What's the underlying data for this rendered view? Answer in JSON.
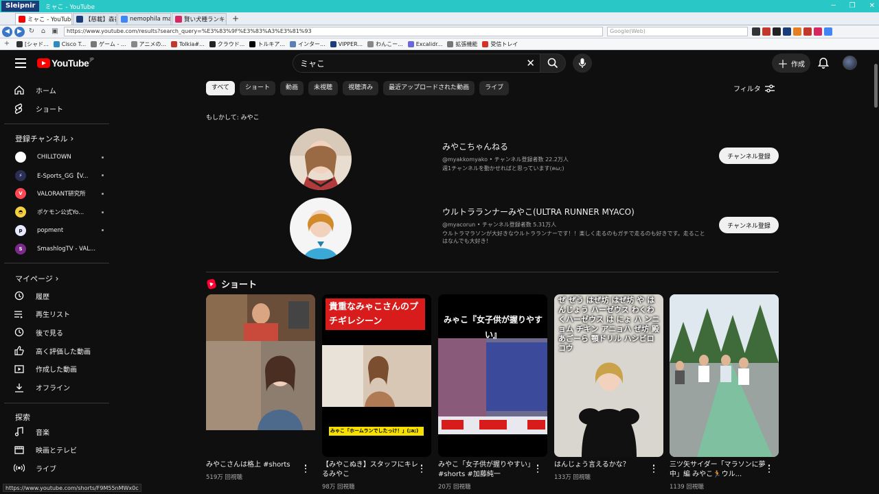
{
  "window": {
    "app": "Sleipnir",
    "title": "ミャこ - YouTube"
  },
  "tabs": [
    {
      "label": "ミャこ - YouTube",
      "color": "#ff0000",
      "active": true
    },
    {
      "label": "【慈載】森香澄 ...",
      "color": "#1a3d7a",
      "active": false
    },
    {
      "label": "nemophila may...",
      "color": "#4285f4",
      "active": false
    },
    {
      "label": "賢い犬種ランキン...",
      "color": "#d6275e",
      "active": false
    }
  ],
  "address": {
    "url": "https://www.youtube.com/results?search_query=%E3%83%9F%E3%83%A3%E3%81%93",
    "search_placeholder": "Google(Web)"
  },
  "bookmarks": [
    {
      "label": "[シャド...",
      "color": "#333333"
    },
    {
      "label": "Cisco T...",
      "color": "#2e8bc0"
    },
    {
      "label": "ゲーム - ...",
      "color": "#777777"
    },
    {
      "label": "アニメの...",
      "color": "#888888"
    },
    {
      "label": "Tolkia#...",
      "color": "#c0392b"
    },
    {
      "label": "クラウド...",
      "color": "#222222"
    },
    {
      "label": "トルキア...",
      "color": "#000000"
    },
    {
      "label": "インター...",
      "color": "#5a7fb5"
    },
    {
      "label": "VIPPER...",
      "color": "#1a3d7a"
    },
    {
      "label": "わんこー...",
      "color": "#888888"
    },
    {
      "label": "Excalidr...",
      "color": "#6965db"
    },
    {
      "label": "拡張機能",
      "color": "#777777"
    },
    {
      "label": "受信トレイ",
      "color": "#d93025"
    }
  ],
  "youtube": {
    "logo_text": "YouTube",
    "region": "JP",
    "search_query": "ミャこ",
    "create_label": "作成",
    "filter_label": "フィルタ",
    "chips": [
      "すべて",
      "ショート",
      "動画",
      "未視聴",
      "視聴済み",
      "最近アップロードされた動画",
      "ライブ"
    ],
    "suggest": "もしかして: みやこ",
    "sidebar": {
      "main": [
        {
          "label": "ホーム",
          "icon": "home-icon"
        },
        {
          "label": "ショート",
          "icon": "shorts-icon"
        }
      ],
      "subs_title": "登録チャンネル",
      "subs": [
        {
          "label": "CHILLTOWN",
          "color": "#ffffff",
          "initial": ""
        },
        {
          "label": "E-Sports_GG【V...",
          "color": "#2b2f55",
          "initial": "⚡"
        },
        {
          "label": "VALORANT研究所",
          "color": "#ff4655",
          "initial": "V"
        },
        {
          "label": "ポケモン公式Yo...",
          "color": "#f4d03f",
          "initial": "◓"
        },
        {
          "label": "popment",
          "color": "#e8eaff",
          "initial": "p"
        },
        {
          "label": "SmashlogTV - VAL...",
          "color": "#7b2a8a",
          "initial": "S"
        }
      ],
      "my_title": "マイページ",
      "my": [
        {
          "label": "履歴",
          "icon": "history-icon"
        },
        {
          "label": "再生リスト",
          "icon": "playlist-icon"
        },
        {
          "label": "後で見る",
          "icon": "watch-later-icon"
        },
        {
          "label": "高く評価した動画",
          "icon": "like-icon"
        },
        {
          "label": "作成した動画",
          "icon": "your-videos-icon"
        },
        {
          "label": "オフライン",
          "icon": "download-icon"
        }
      ],
      "explore_title": "探索",
      "explore": [
        {
          "label": "音楽",
          "icon": "music-icon"
        },
        {
          "label": "映画とテレビ",
          "icon": "movies-icon"
        },
        {
          "label": "ライブ",
          "icon": "live-icon"
        }
      ]
    },
    "channels": [
      {
        "name": "みやこちゃんねる",
        "meta": "@myakkomyako • チャンネル登録者数 22.2万人",
        "desc": "週1チャンネルを動かせればと思っています(ฅω;)",
        "button": "チャンネル登録"
      },
      {
        "name": "ウルトラランナーみやこ(ULTRA RUNNER MYACO)",
        "meta": "@myacorun • チャンネル登録者数 5.31万人",
        "desc": "ウルトラマラソンが大好きなウルトラランナーです！！楽しく走るのもガチで走るのも好きです。走ることはなんでも大好き！",
        "button": "チャンネル登録"
      }
    ],
    "shorts_title": "ショート",
    "shorts": [
      {
        "title": "みやこさんは格上 #shorts",
        "views": "519万 回視聴",
        "overlay": ""
      },
      {
        "title": "【みやこぬき】スタッフにキレるみやこ",
        "views": "98万 回視聴",
        "overlay": "貴重なみゃこさんのプチギレシーン",
        "caption": "みゃこ「ホームランでしたっけ！」(;a;)"
      },
      {
        "title": "みやこ「女子供が握りやすい」#shorts #加藤純一",
        "views": "20万 回視聴",
        "overlay": "みゃこ『女子供が握りやすい』"
      },
      {
        "title": "はんじょう言えるかな？",
        "views": "133万 回視聴",
        "overlay": "ぜ ぜう はぜ坊 はぜ坊 や はんじょう ハーゼウス わくわくハーゼウス は にょ ハ ンニョム チキン アニョハ ぜ坊 殿 あごーら 顎ドリル ハシビロコウ"
      },
      {
        "title": "三ツ矢サイダー「マラソンに夢中」編 みやこ🏃ウル...",
        "views": "1139 回視聴",
        "overlay": ""
      }
    ]
  },
  "statusbar": "https://www.youtube.com/shorts/F9M55nMWx0c"
}
